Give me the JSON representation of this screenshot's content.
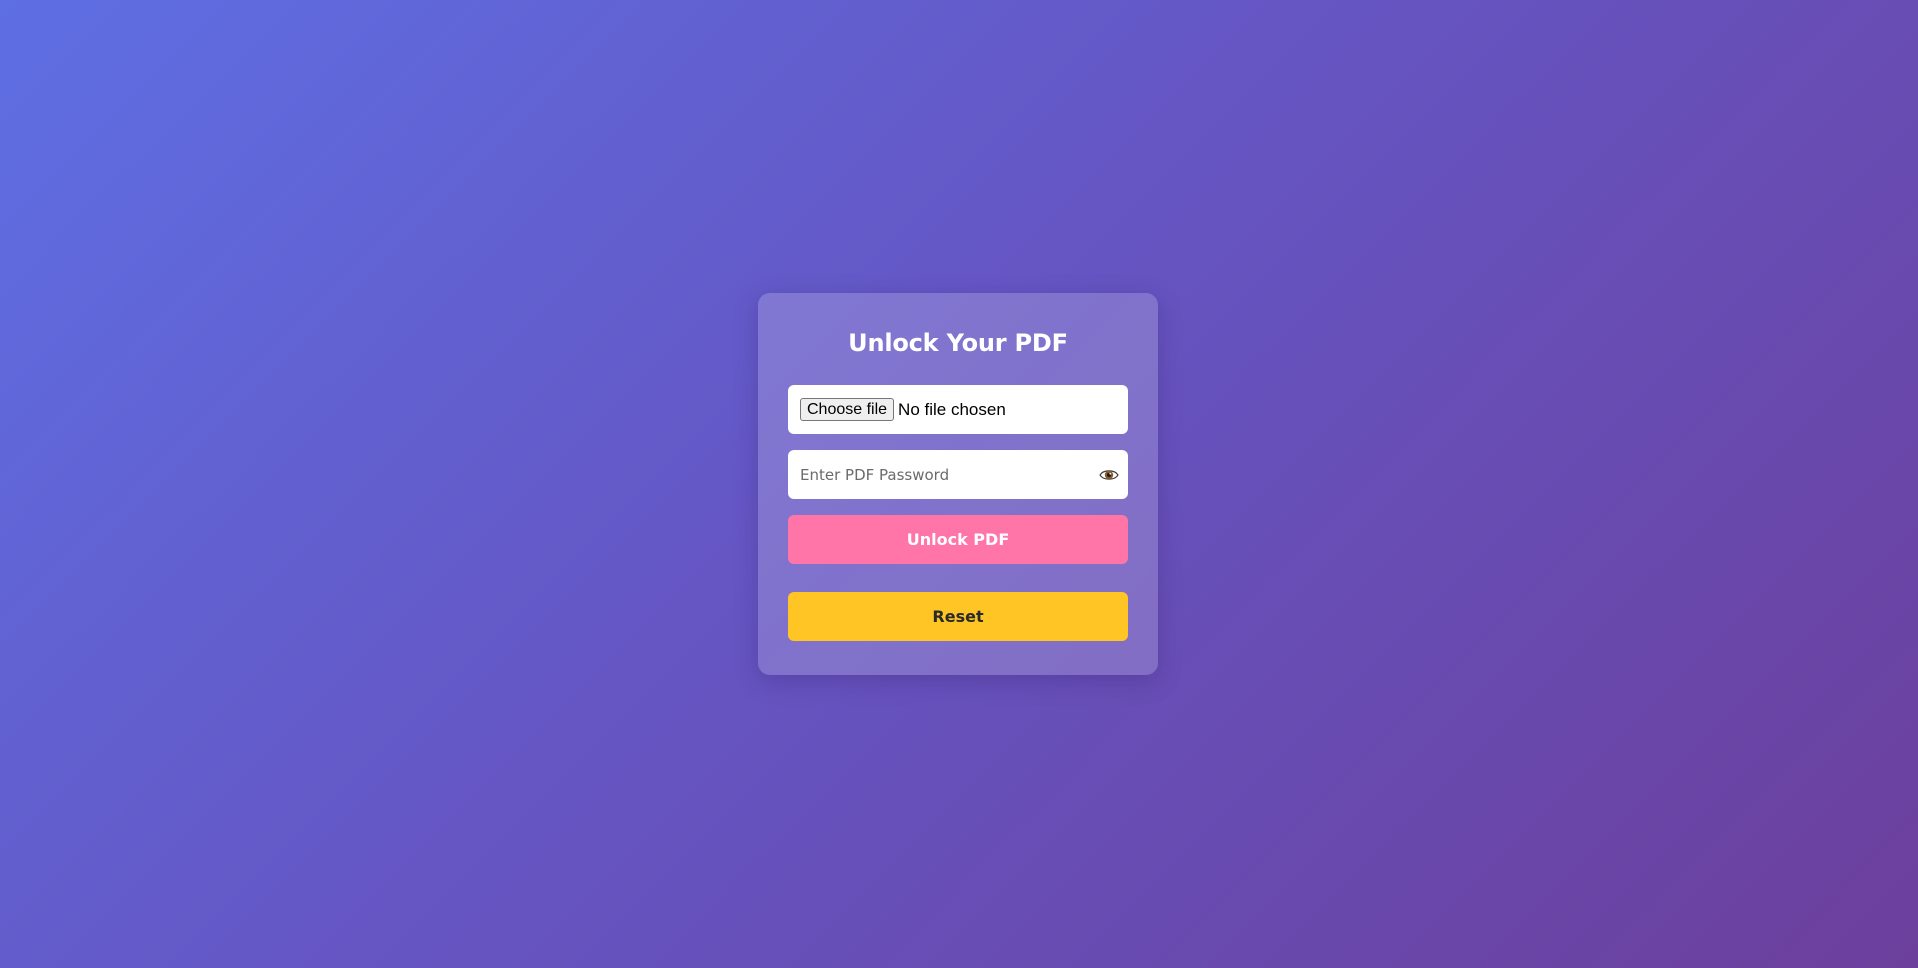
{
  "card": {
    "title": "Unlock Your PDF",
    "file_picker": {
      "button_label": "Choose file",
      "status_text": "No file chosen"
    },
    "password": {
      "placeholder": "Enter PDF Password",
      "value": "",
      "toggle_icon": "eye-icon"
    },
    "unlock_button_label": "Unlock PDF",
    "reset_button_label": "Reset"
  },
  "colors": {
    "background_start": "#5e6fe3",
    "background_end": "#6c3f9c",
    "unlock_button": "#ff75a8",
    "reset_button": "#ffc524",
    "title_text": "#ffffff"
  }
}
